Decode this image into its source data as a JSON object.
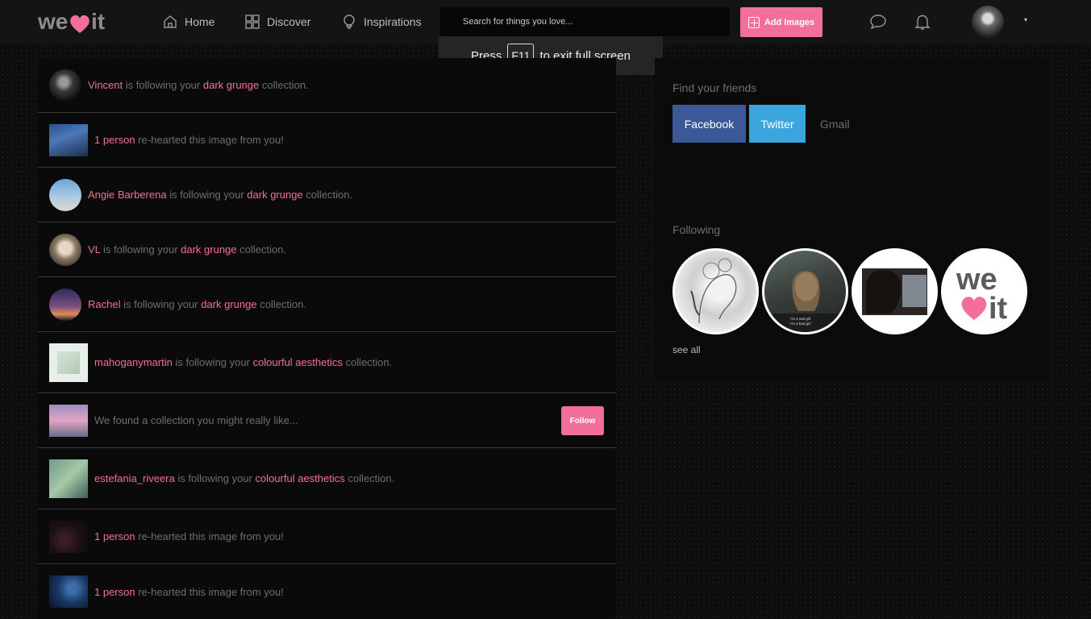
{
  "header": {
    "logo_text": "weheartit",
    "nav": [
      {
        "label": "Home",
        "icon": "home-icon"
      },
      {
        "label": "Discover",
        "icon": "grid-icon"
      },
      {
        "label": "Inspirations",
        "icon": "lightbulb-icon"
      }
    ],
    "search_placeholder": "Search for things you love...",
    "add_images_label": "Add Images",
    "messages_icon": "chat-bubble-icon",
    "notifications_icon": "bell-icon",
    "caret": "▾"
  },
  "fullscreen_tip": {
    "press": "Press",
    "key": "F11",
    "rest": "to exit full screen"
  },
  "feed": [
    {
      "actor": "Vincent",
      "action": " is following your ",
      "collection": "dark grunge",
      "suffix": " collection."
    },
    {
      "actor": "1 person",
      "action": " re-hearted this image from you!",
      "collection": "",
      "suffix": ""
    },
    {
      "actor": "Angie Barberena",
      "action": " is following your ",
      "collection": "dark grunge",
      "suffix": " collection."
    },
    {
      "actor": "VL",
      "action": " is following your ",
      "collection": "dark grunge",
      "suffix": " collection."
    },
    {
      "actor": "Rachel",
      "action": " is following your ",
      "collection": "dark grunge",
      "suffix": " collection."
    },
    {
      "actor": "mahoganymartin",
      "action": " is following your ",
      "collection": "colourful aesthetics",
      "suffix": " collection."
    },
    {
      "actor": "",
      "action": "We found a collection you might really like...",
      "collection": "",
      "suffix": "",
      "button": "Follow"
    },
    {
      "actor": "estefania_riveera",
      "action": " is following your ",
      "collection": "colourful aesthetics",
      "suffix": " collection."
    },
    {
      "actor": "1 person",
      "action": " re-hearted this image from you!",
      "collection": "",
      "suffix": ""
    },
    {
      "actor": "1 person",
      "action": " re-hearted this image from you!",
      "collection": "",
      "suffix": ""
    }
  ],
  "sidebar": {
    "find_friends_title": "Find your friends",
    "facebook_label": "Facebook",
    "twitter_label": "Twitter",
    "gmail_label": "Gmail",
    "following_title": "Following",
    "following_caption": "I'm a sad girl\nI'm a bad girl",
    "following_logo_we": "we",
    "following_logo_it": "it",
    "see_all_label": "see all"
  },
  "colors": {
    "accent_pink": "#f36f9b",
    "facebook_blue": "#3b5998",
    "twitter_blue": "#3aa6dd"
  }
}
